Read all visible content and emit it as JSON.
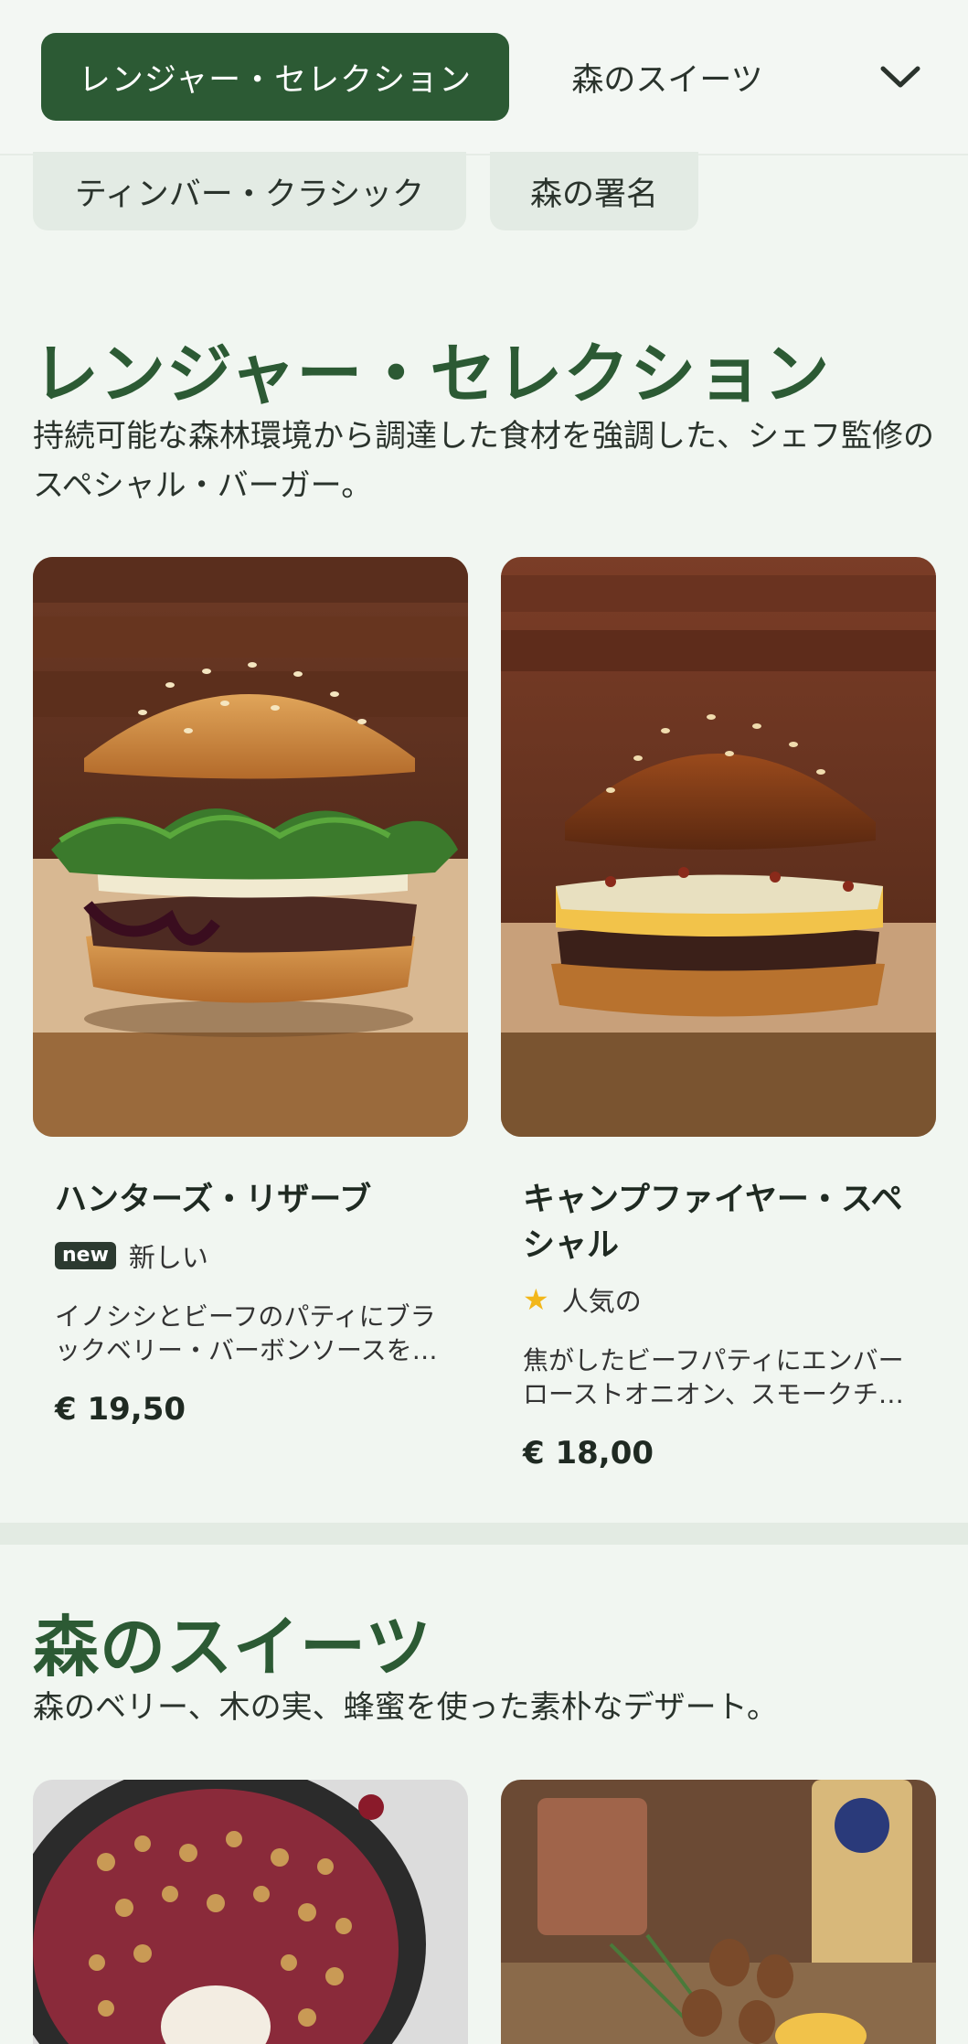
{
  "category_bar": {
    "active_tab": "レンジャー・セレクション",
    "second_tab": "森のスイーツ",
    "expand_icon": "chevron-down-icon",
    "row2": [
      "ティンバー・クラシック",
      "森の署名"
    ]
  },
  "sections": [
    {
      "title": "レンジャー・セレクション",
      "description": "持続可能な森林環境から調達した食材を強調した、シェフ監修のスペシャル・バーガー。",
      "items": [
        {
          "name": "ハンターズ・リザーブ",
          "badge": "new",
          "tag": "新しい",
          "description": "イノシシとビーフのパティにブラックベリー・バーボンソースを添えて",
          "price": "€ 19,50"
        },
        {
          "name": "キャンプファイヤー・スペシャル",
          "badge_icon": "star-icon",
          "tag": "人気の",
          "description": "焦がしたビーフパティにエンバーローストオニオン、スモークチーズ",
          "price": "€ 18,00"
        }
      ]
    },
    {
      "title": "森のスイーツ",
      "description": "森のベリー、木の実、蜂蜜を使った素朴なデザート。"
    }
  ],
  "colors": {
    "brand_green": "#2c5a34",
    "background": "#f1f6f1",
    "pill_bg": "#e3ebe4",
    "star": "#f2b71a"
  }
}
